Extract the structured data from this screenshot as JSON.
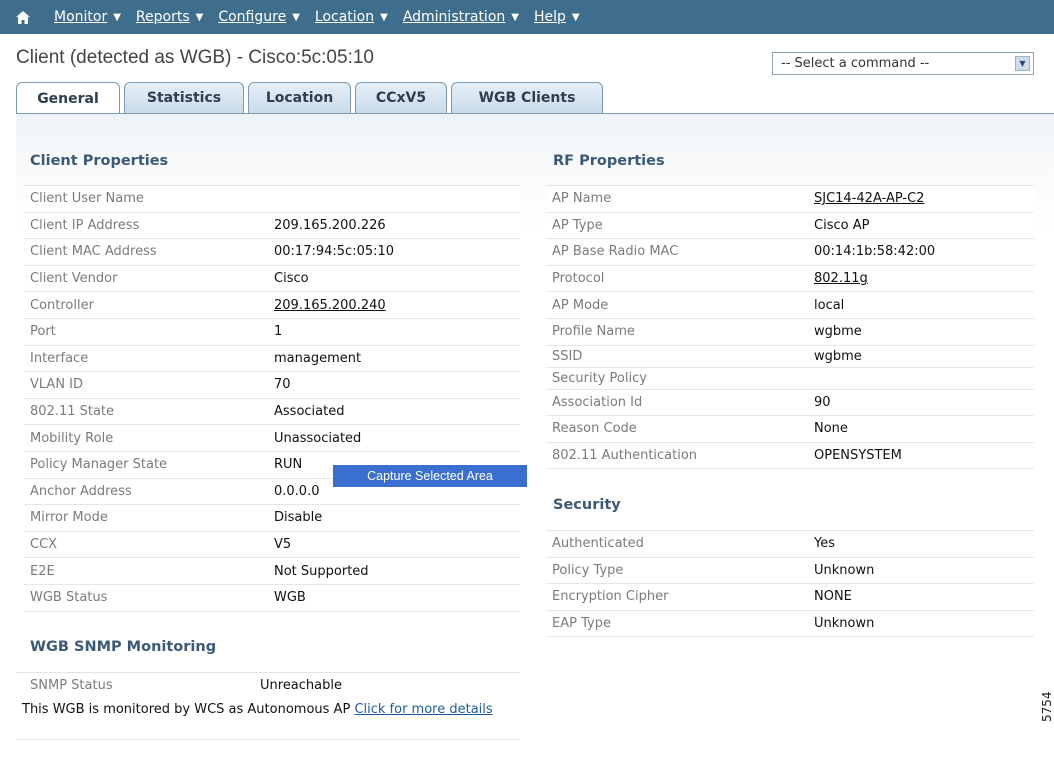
{
  "nav": {
    "items": [
      {
        "label": "Monitor"
      },
      {
        "label": "Reports"
      },
      {
        "label": "Configure"
      },
      {
        "label": "Location"
      },
      {
        "label": "Administration"
      },
      {
        "label": "Help"
      }
    ]
  },
  "page": {
    "title": "Client (detected as WGB) - Cisco:5c:05:10",
    "command_select": "-- Select a command --"
  },
  "tabs": [
    {
      "label": "General"
    },
    {
      "label": "Statistics"
    },
    {
      "label": "Location"
    },
    {
      "label": "CCxV5"
    },
    {
      "label": "WGB Clients"
    }
  ],
  "client_properties": {
    "title": "Client Properties",
    "rows": [
      {
        "key": "Client User Name",
        "value": ""
      },
      {
        "key": "Client IP Address",
        "value": "209.165.200.226"
      },
      {
        "key": "Client MAC Address",
        "value": "00:17:94:5c:05:10"
      },
      {
        "key": "Client Vendor",
        "value": "Cisco"
      },
      {
        "key": "Controller",
        "value": "209.165.200.240"
      },
      {
        "key": "Port",
        "value": "1"
      },
      {
        "key": "Interface",
        "value": "management"
      },
      {
        "key": "VLAN ID",
        "value": "70"
      },
      {
        "key": "802.11 State",
        "value": "Associated"
      },
      {
        "key": "Mobility Role",
        "value": "Unassociated"
      },
      {
        "key": "Policy Manager State",
        "value": "RUN"
      },
      {
        "key": "Anchor Address",
        "value": "0.0.0.0"
      },
      {
        "key": "Mirror Mode",
        "value": "Disable"
      },
      {
        "key": "CCX",
        "value": "V5"
      },
      {
        "key": "E2E",
        "value": "Not Supported"
      },
      {
        "key": "WGB Status",
        "value": "WGB"
      }
    ]
  },
  "wgb_snmp": {
    "title": "WGB SNMP Monitoring",
    "status_key": "SNMP Status",
    "status_value": "Unreachable",
    "note": "This WGB is monitored by WCS as Autonomous AP",
    "note_link": "Click for more details"
  },
  "rf_properties": {
    "title": "RF Properties",
    "rows": [
      {
        "key": "AP Name",
        "value": "SJC14-42A-AP-C2"
      },
      {
        "key": "AP Type",
        "value": "Cisco AP"
      },
      {
        "key": "AP Base Radio MAC",
        "value": "00:14:1b:58:42:00"
      },
      {
        "key": "Protocol",
        "value": "802.11g"
      },
      {
        "key": "AP Mode",
        "value": "local"
      },
      {
        "key": "Profile Name",
        "value": "wgbme"
      },
      {
        "key": "SSID",
        "value": "wgbme"
      },
      {
        "key": "Security Policy",
        "value": ""
      },
      {
        "key": "Association Id",
        "value": "90"
      },
      {
        "key": "Reason Code",
        "value": "None"
      },
      {
        "key": "802.11 Authentication",
        "value": "OPENSYSTEM"
      }
    ]
  },
  "security": {
    "title": "Security",
    "rows": [
      {
        "key": "Authenticated",
        "value": "Yes"
      },
      {
        "key": "Policy Type",
        "value": "Unknown"
      },
      {
        "key": "Encryption Cipher",
        "value": "NONE"
      },
      {
        "key": "EAP Type",
        "value": "Unknown"
      }
    ]
  },
  "context_menu": {
    "label": "Capture Selected Area"
  },
  "figure_number": "5754"
}
